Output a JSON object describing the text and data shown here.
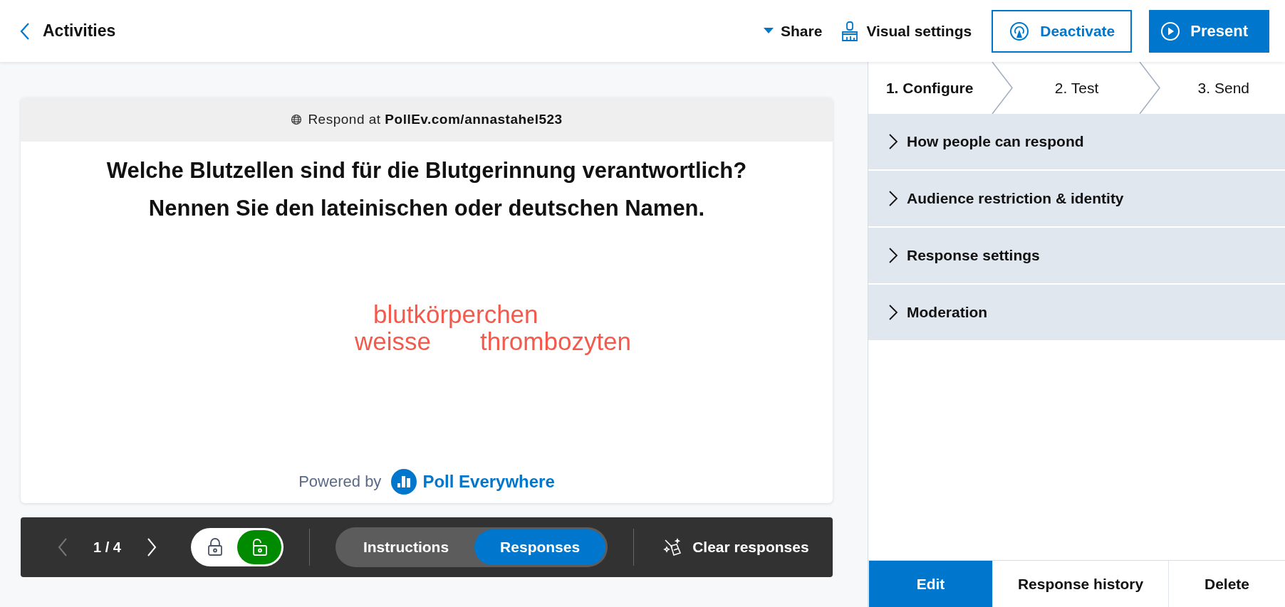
{
  "header": {
    "back_label": "Activities",
    "share_label": "Share",
    "visual_settings_label": "Visual settings",
    "deactivate_label": "Deactivate",
    "present_label": "Present"
  },
  "slide": {
    "respond_prefix": "Respond at",
    "respond_url": "PollEv.com/annastahel523",
    "question": [
      "Welche Blutzellen sind für die Blutgerinnung verantwortlich?",
      "Nennen Sie den lateinischen oder deutschen Namen."
    ],
    "words": [
      {
        "text": "blutkörperchen",
        "color": "#f4594b"
      },
      {
        "text": "weisse",
        "color": "#f4594b"
      },
      {
        "text": "thrombozyten",
        "color": "#f4594b"
      }
    ],
    "powered_by": "Powered by",
    "brand": "Poll Everywhere"
  },
  "toolbar": {
    "page": "1 / 4",
    "lock": [
      {
        "kind": "locked",
        "selected": false
      },
      {
        "kind": "unlocked",
        "selected": true
      }
    ],
    "views": [
      {
        "label": "Instructions",
        "selected": false
      },
      {
        "label": "Responses",
        "selected": true
      }
    ],
    "clear_label": "Clear responses"
  },
  "steps": [
    {
      "label": "1. Configure",
      "selected": true
    },
    {
      "label": "2. Test",
      "selected": false
    },
    {
      "label": "3. Send",
      "selected": false
    }
  ],
  "sections": [
    {
      "label": "How people can respond",
      "expanded": false
    },
    {
      "label": "Audience restriction & identity",
      "expanded": false
    },
    {
      "label": "Response settings",
      "expanded": false
    },
    {
      "label": "Moderation",
      "expanded": false
    }
  ],
  "actions": [
    {
      "label": "Edit",
      "selected": true
    },
    {
      "label": "Response history",
      "selected": false
    },
    {
      "label": "Delete",
      "selected": false
    }
  ]
}
